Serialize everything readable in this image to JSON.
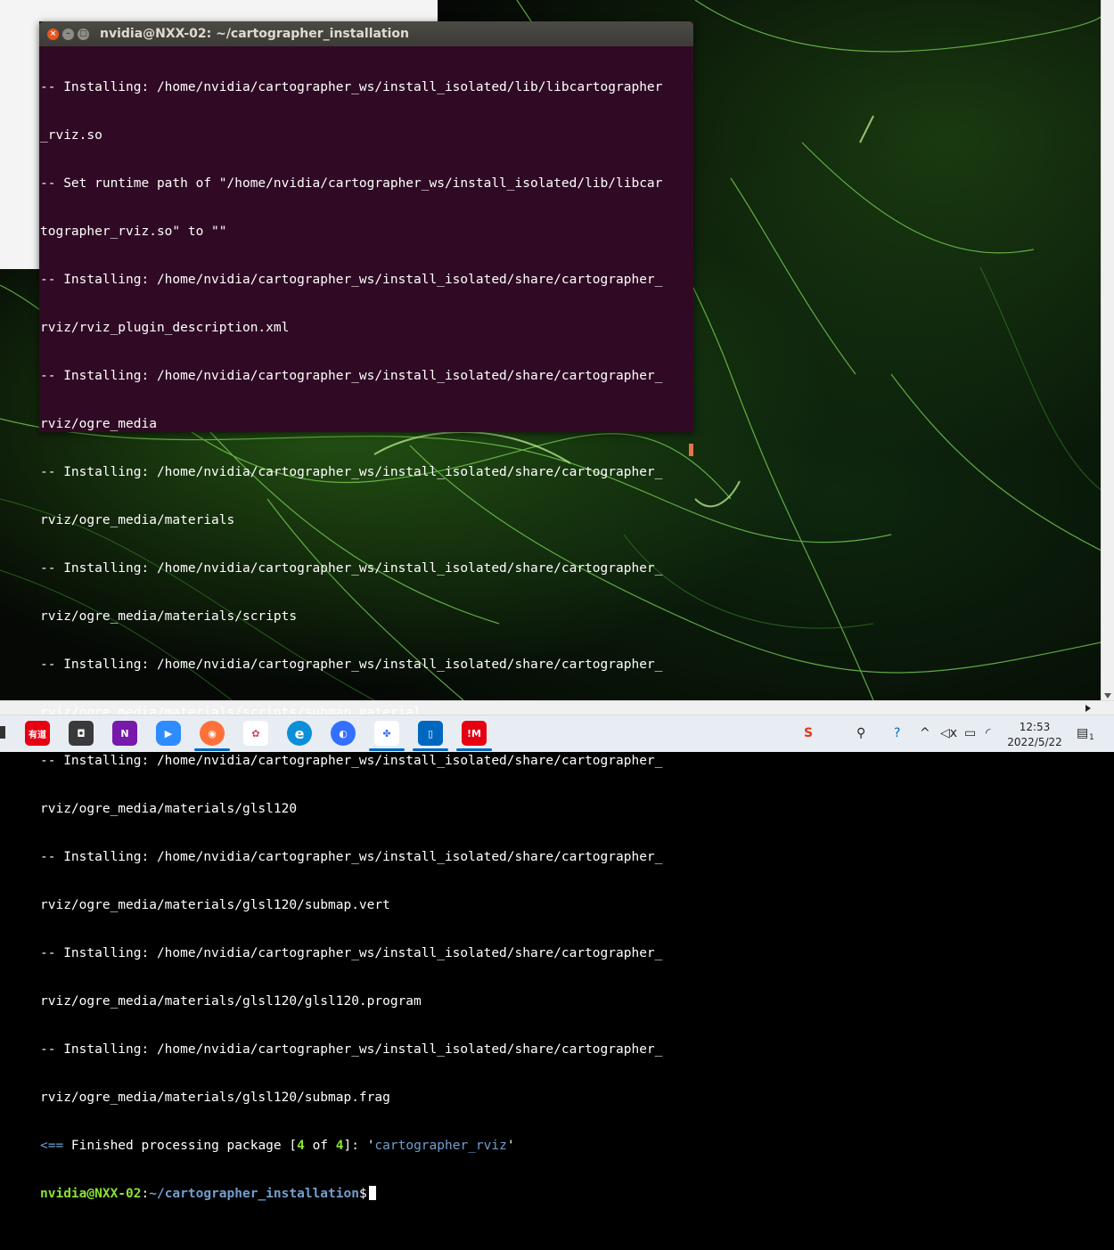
{
  "terminal": {
    "title": "nvidia@NXX-02: ~/cartographer_installation",
    "lines": [
      "-- Installing: /home/nvidia/cartographer_ws/install_isolated/lib/libcartographer",
      "_rviz.so",
      "-- Set runtime path of \"/home/nvidia/cartographer_ws/install_isolated/lib/libcar",
      "tographer_rviz.so\" to \"\"",
      "-- Installing: /home/nvidia/cartographer_ws/install_isolated/share/cartographer_",
      "rviz/rviz_plugin_description.xml",
      "-- Installing: /home/nvidia/cartographer_ws/install_isolated/share/cartographer_",
      "rviz/ogre_media",
      "-- Installing: /home/nvidia/cartographer_ws/install_isolated/share/cartographer_",
      "rviz/ogre_media/materials",
      "-- Installing: /home/nvidia/cartographer_ws/install_isolated/share/cartographer_",
      "rviz/ogre_media/materials/scripts",
      "-- Installing: /home/nvidia/cartographer_ws/install_isolated/share/cartographer_",
      "rviz/ogre_media/materials/scripts/submap.material",
      "-- Installing: /home/nvidia/cartographer_ws/install_isolated/share/cartographer_",
      "rviz/ogre_media/materials/glsl120",
      "-- Installing: /home/nvidia/cartographer_ws/install_isolated/share/cartographer_",
      "rviz/ogre_media/materials/glsl120/submap.vert",
      "-- Installing: /home/nvidia/cartographer_ws/install_isolated/share/cartographer_",
      "rviz/ogre_media/materials/glsl120/glsl120.program",
      "-- Installing: /home/nvidia/cartographer_ws/install_isolated/share/cartographer_",
      "rviz/ogre_media/materials/glsl120/submap.frag"
    ],
    "finished": {
      "arrow": "<==",
      "text_before": " Finished processing package [",
      "current": "4",
      "of_text": " of ",
      "total": "4",
      "text_mid": "]: '",
      "package": "cartographer_rviz",
      "text_end": "'"
    },
    "prompt": {
      "user_host": "nvidia@NXX-02",
      "colon": ":",
      "path": "~/cartographer_installation",
      "dollar": "$"
    },
    "buttons": {
      "close": "×",
      "minimize": "–",
      "maximize": "□"
    }
  },
  "taskbar": {
    "apps": [
      {
        "name": "youdao",
        "label": "有道",
        "color": "#e60012"
      },
      {
        "name": "camera",
        "label": "◘",
        "color": "#333333"
      },
      {
        "name": "onenote",
        "label": "N",
        "color": "#7719aa"
      },
      {
        "name": "zoom",
        "label": "▶",
        "color": "#2d8cff"
      },
      {
        "name": "firefox",
        "label": "◉",
        "color": "#ff7139"
      },
      {
        "name": "app-network",
        "label": "✿",
        "color": "#ffffff"
      },
      {
        "name": "edge",
        "label": "e",
        "color": "#0c8fd8"
      },
      {
        "name": "feishu",
        "label": "◐",
        "color": "#3370ff"
      },
      {
        "name": "baidu-netdisk",
        "label": "✤",
        "color": "#ffffff"
      },
      {
        "name": "phone-link",
        "label": "▯",
        "color": "#0067c0"
      },
      {
        "name": "app-red",
        "label": "!M",
        "color": "#e60012"
      }
    ],
    "tray": {
      "time": "12:53",
      "date": "2022/5/22",
      "notifications_badge": "1"
    }
  }
}
